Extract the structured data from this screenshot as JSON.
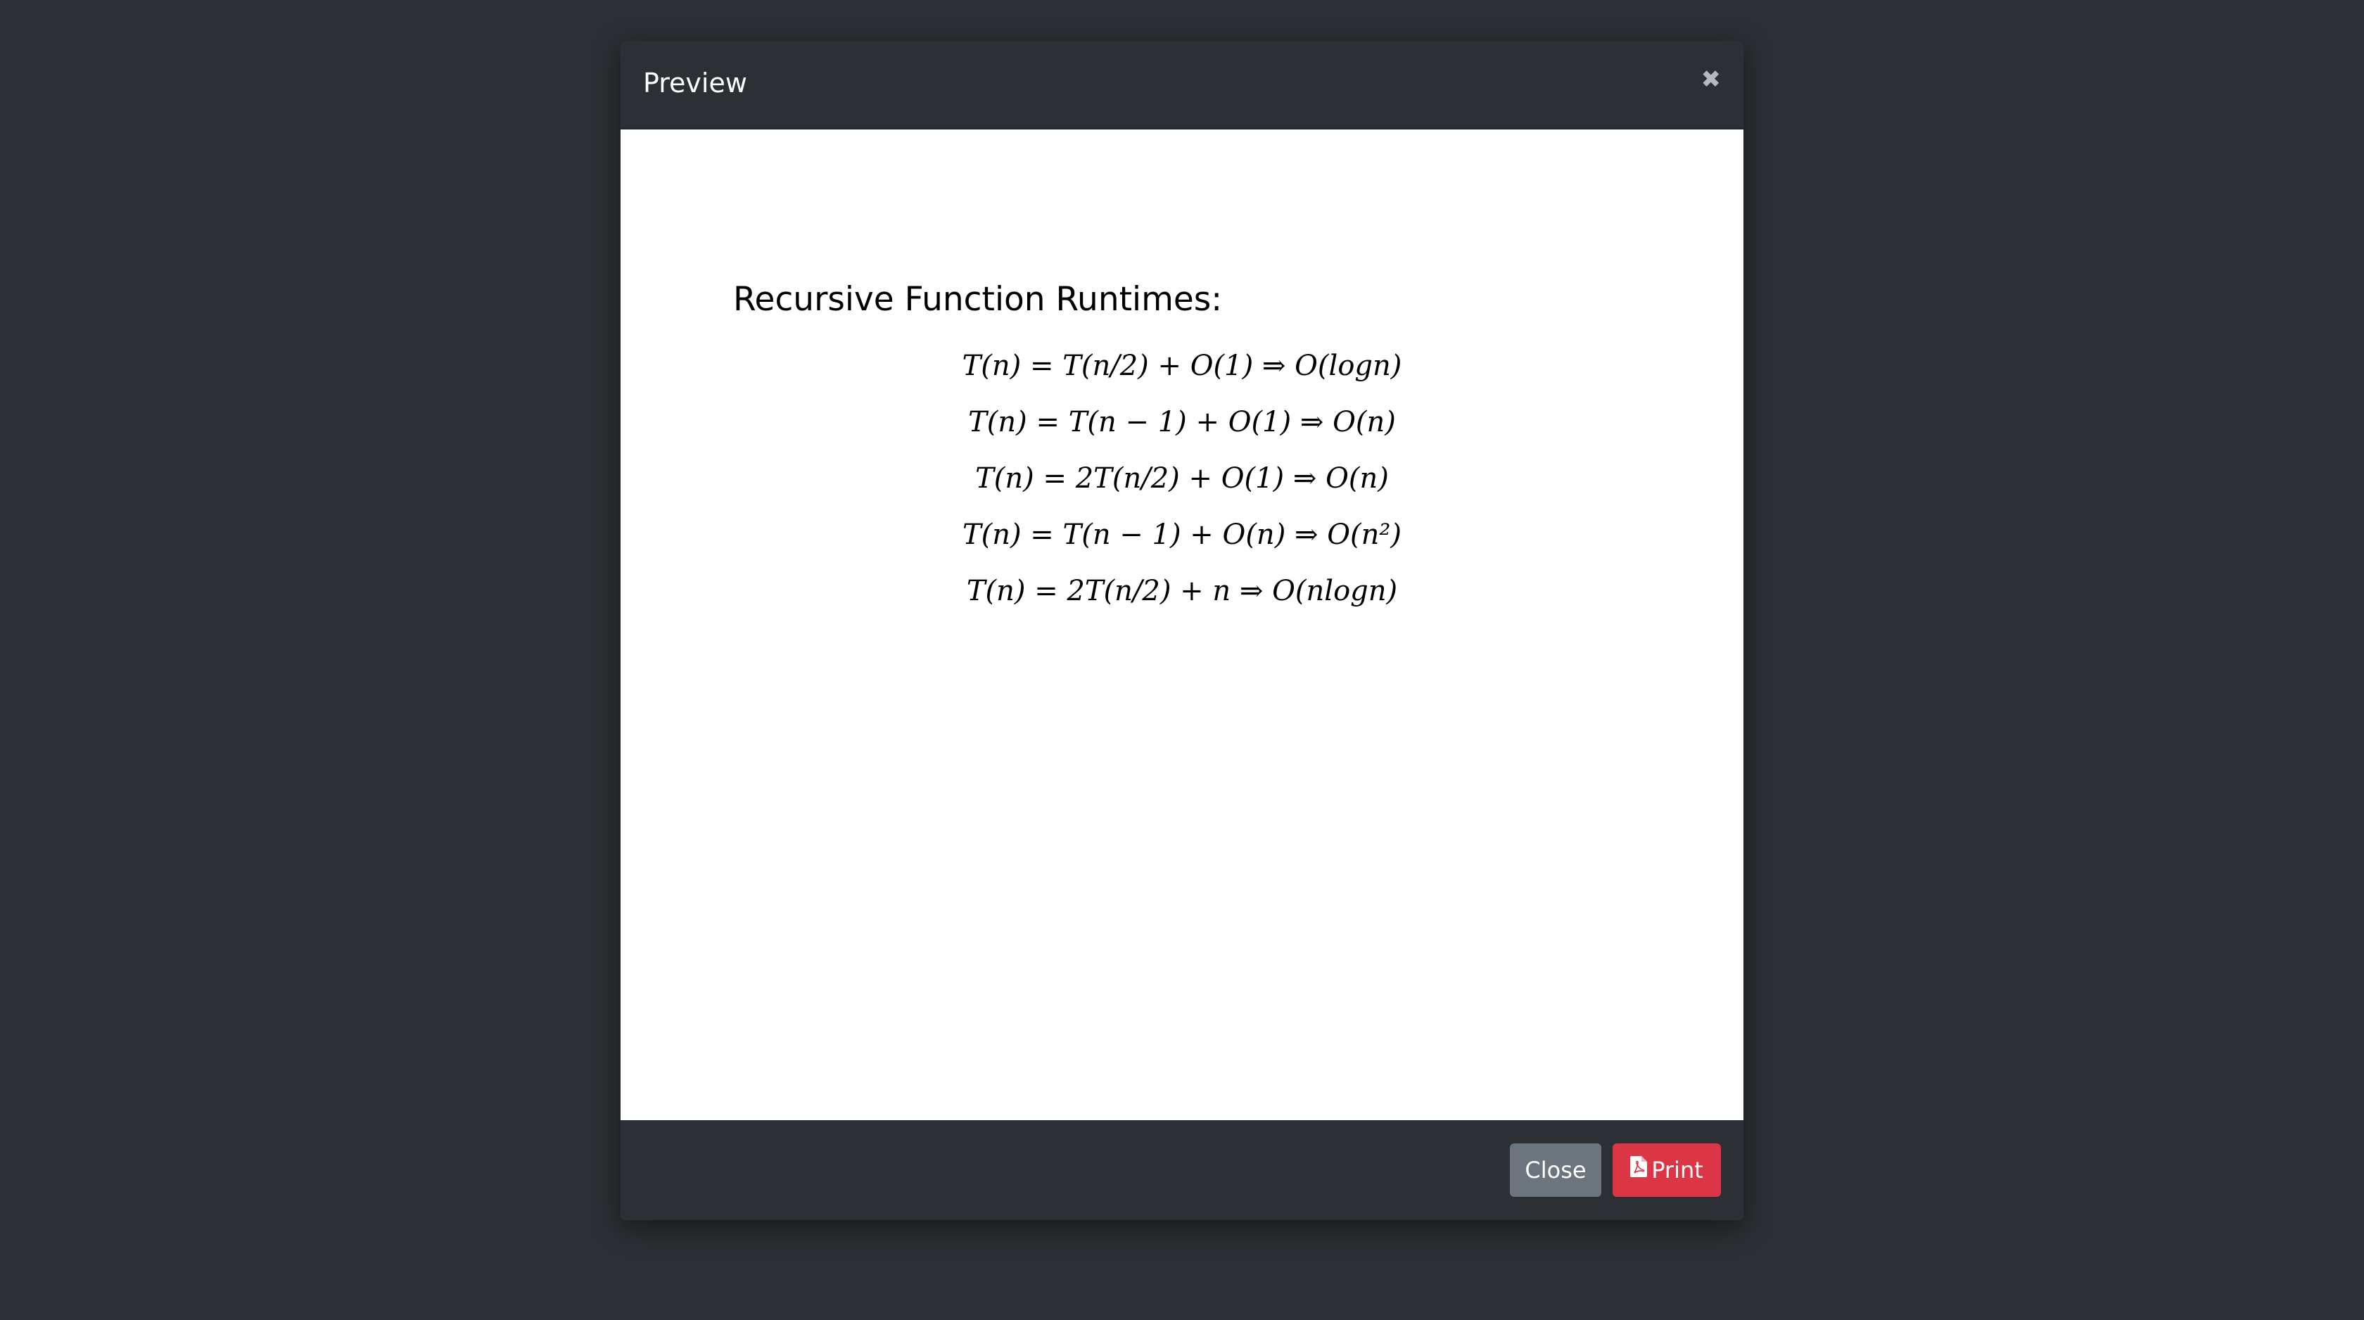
{
  "modal": {
    "title": "Preview",
    "close_glyph": "✖"
  },
  "document": {
    "heading": "Recursive Function Runtimes:",
    "equations": [
      "T(n) = T(n/2) + O(1) ⇒ O(logn)",
      "T(n) = T(n − 1) + O(1) ⇒ O(n)",
      "T(n) = 2T(n/2) + O(1) ⇒ O(n)",
      "T(n) = T(n − 1) + O(n) ⇒ O(n²)",
      "T(n) = 2T(n/2) + n ⇒ O(nlogn)"
    ]
  },
  "footer": {
    "close_label": "Close",
    "print_label": "Print",
    "print_icon": "pdf-file-icon"
  },
  "colors": {
    "background": "#2c2f33",
    "close_button": "#6c757d",
    "print_button": "#dc3545"
  }
}
